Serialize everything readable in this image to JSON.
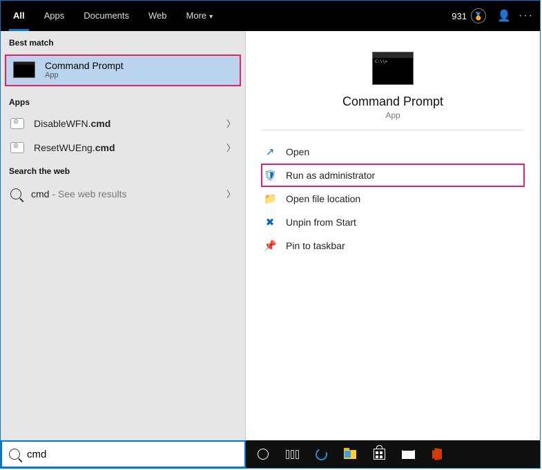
{
  "tabs": {
    "all": "All",
    "apps": "Apps",
    "documents": "Documents",
    "web": "Web",
    "more": "More"
  },
  "rewards_points": "931",
  "sections": {
    "best_match": "Best match",
    "apps": "Apps",
    "search_web": "Search the web"
  },
  "best_match": {
    "title": "Command Prompt",
    "subtitle": "App"
  },
  "apps_results": [
    {
      "prefix": "DisableWFN.",
      "bold": "cmd"
    },
    {
      "prefix": "ResetWUEng.",
      "bold": "cmd"
    }
  ],
  "web_result": {
    "query": "cmd",
    "suffix": " - See web results"
  },
  "preview": {
    "title": "Command Prompt",
    "subtitle": "App"
  },
  "actions": {
    "open": "Open",
    "run_admin": "Run as administrator",
    "open_loc": "Open file location",
    "unpin_start": "Unpin from Start",
    "pin_taskbar": "Pin to taskbar"
  },
  "search_value": "cmd"
}
